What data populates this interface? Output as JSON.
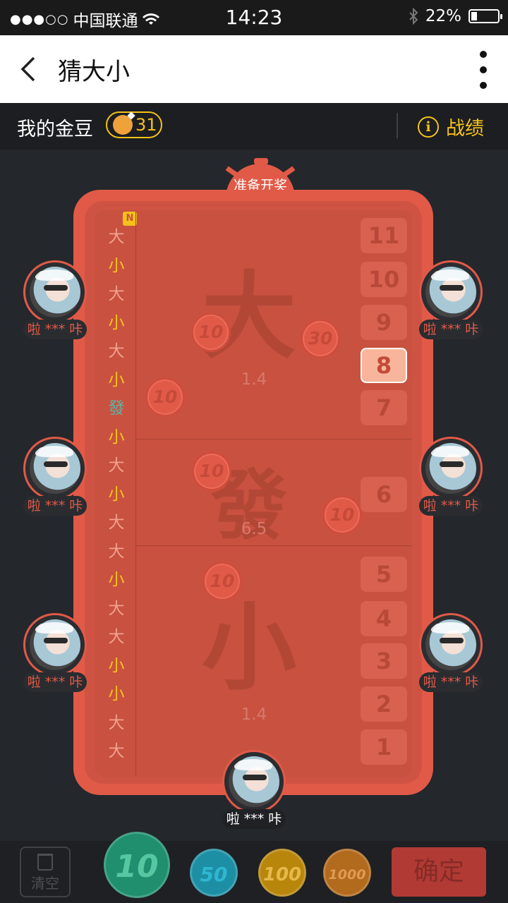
{
  "status_bar": {
    "signal": "●●●○○",
    "carrier": "中国联通",
    "time": "14:23",
    "battery": "22%",
    "battery_level": 0.22
  },
  "nav": {
    "title": "猜大小"
  },
  "gold": {
    "label": "我的金豆",
    "amount": "31",
    "record": "战绩",
    "info_glyph": "i"
  },
  "timer": {
    "label": "准备开奖"
  },
  "history": {
    "badge": "N",
    "items": [
      "大",
      "小",
      "大",
      "小",
      "大",
      "小",
      "發",
      "小",
      "大",
      "小",
      "大",
      "大",
      "小",
      "大",
      "大",
      "小",
      "小",
      "大",
      "大"
    ]
  },
  "zones": {
    "big": {
      "char": "大",
      "odds": "1.4"
    },
    "mid": {
      "char": "發",
      "odds": "6.5"
    },
    "small": {
      "char": "小",
      "odds": "1.4"
    }
  },
  "numbers": [
    "11",
    "10",
    "9",
    "8",
    "7",
    "6",
    "5",
    "4",
    "3",
    "2",
    "1"
  ],
  "selected_number": "8",
  "placed_chips": [
    "10",
    "30",
    "10",
    "10",
    "10",
    "10"
  ],
  "seats": {
    "left1": "啦 *** 咔",
    "left2": "啦 *** 咔",
    "left3": "啦 *** 咔",
    "right1": "啦 *** 咔",
    "right2": "啦 *** 咔",
    "right3": "啦 *** 咔",
    "me": "啦 *** 咔"
  },
  "bottom": {
    "clear": "清空",
    "chips": [
      "10",
      "50",
      "100",
      "1000"
    ],
    "confirm": "确定"
  },
  "colors": {
    "board": "#e15a48",
    "gold": "#f5c21b",
    "chip10": "#1f8f6e",
    "chip50": "#1d8fa5",
    "chip100": "#b8860b",
    "chip1000": "#b26a1c"
  }
}
